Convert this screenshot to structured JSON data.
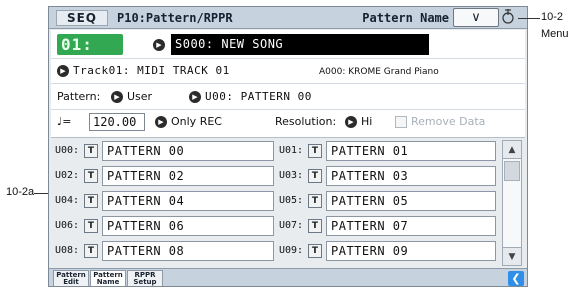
{
  "topbar": {
    "mode": "SEQ",
    "page_title": "P10:Pattern/RPPR",
    "page_name": "Pattern Name",
    "menu_symbol": "∨"
  },
  "song": {
    "measure_display": "01:",
    "song_label": "S000: NEW SONG"
  },
  "track": {
    "track_label": "Track01: MIDI TRACK 01",
    "program_label": "A000: KROME Grand Piano"
  },
  "pattern_select": {
    "label": "Pattern:",
    "bank": "User",
    "pattern": "U00: PATTERN 00"
  },
  "tempo_row": {
    "note_symbol": "♩=",
    "tempo": "120.00",
    "rec_mode": "Only REC",
    "resolution_label": "Resolution:",
    "resolution_value": "Hi",
    "remove_data_label": "Remove Data",
    "remove_data_checked": false
  },
  "patterns": [
    {
      "id": "U00:",
      "name": "PATTERN 00"
    },
    {
      "id": "U01:",
      "name": "PATTERN 01"
    },
    {
      "id": "U02:",
      "name": "PATTERN 02"
    },
    {
      "id": "U03:",
      "name": "PATTERN 03"
    },
    {
      "id": "U04:",
      "name": "PATTERN 04"
    },
    {
      "id": "U05:",
      "name": "PATTERN 05"
    },
    {
      "id": "U06:",
      "name": "PATTERN 06"
    },
    {
      "id": "U07:",
      "name": "PATTERN 07"
    },
    {
      "id": "U08:",
      "name": "PATTERN 08"
    },
    {
      "id": "U09:",
      "name": "PATTERN 09"
    }
  ],
  "text_edit_symbol": "T",
  "tabs": [
    {
      "line1": "Pattern",
      "line2": "Edit",
      "active": false
    },
    {
      "line1": "Pattern",
      "line2": "Name",
      "active": true
    },
    {
      "line1": "RPPR",
      "line2": "Setup",
      "active": false
    }
  ],
  "callouts": {
    "menu_ref": "10-2",
    "menu_text": "Menu",
    "list_ref": "10-2a"
  },
  "colors": {
    "lcd_green": "#33a853",
    "song_box": "#000000",
    "accent_blue": "#2f8fe8"
  }
}
